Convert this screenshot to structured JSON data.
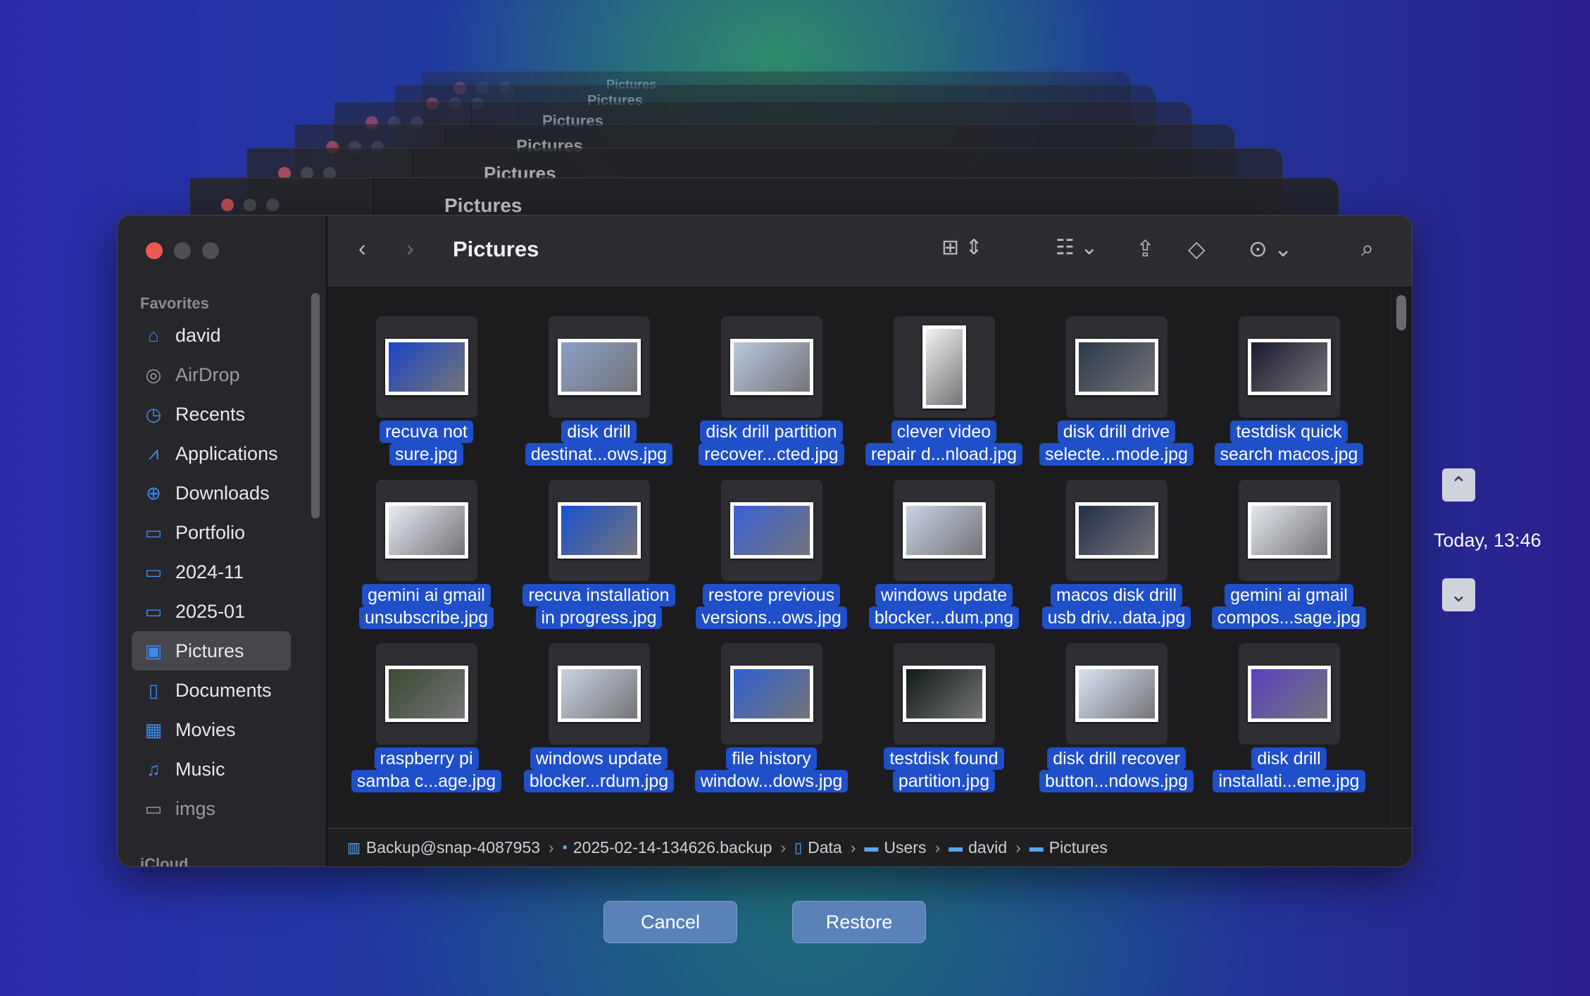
{
  "window": {
    "title": "Pictures"
  },
  "background_windows": [
    "Pictures",
    "Pictures",
    "Pictures",
    "Pictures",
    "Pictures",
    "Pictures"
  ],
  "sidebar": {
    "section_favorites": "Favorites",
    "section_icloud": "iCloud",
    "selected": "Pictures",
    "items": [
      {
        "label": "david",
        "icon": "house-icon",
        "glyph": "⌂"
      },
      {
        "label": "AirDrop",
        "icon": "airdrop-icon",
        "glyph": "◎",
        "gray": true
      },
      {
        "label": "Recents",
        "icon": "clock-icon",
        "glyph": "◷"
      },
      {
        "label": "Applications",
        "icon": "applications-icon",
        "glyph": "⩘"
      },
      {
        "label": "Downloads",
        "icon": "download-icon",
        "glyph": "⊕"
      },
      {
        "label": "Portfolio",
        "icon": "folder-icon",
        "glyph": "▭"
      },
      {
        "label": "2024-11",
        "icon": "folder-icon",
        "glyph": "▭"
      },
      {
        "label": "2025-01",
        "icon": "folder-icon",
        "glyph": "▭"
      },
      {
        "label": "Pictures",
        "icon": "pictures-icon",
        "glyph": "▣"
      },
      {
        "label": "Documents",
        "icon": "document-icon",
        "glyph": "▯"
      },
      {
        "label": "Movies",
        "icon": "film-icon",
        "glyph": "▦"
      },
      {
        "label": "Music",
        "icon": "music-icon",
        "glyph": "♫"
      },
      {
        "label": "imgs",
        "icon": "folder-icon",
        "glyph": "▭",
        "gray": true
      }
    ]
  },
  "toolbar": {
    "back": "‹",
    "forward": "›"
  },
  "files": [
    {
      "line1": "recuva not",
      "line2": "sure.jpg",
      "color": "#1a44c8"
    },
    {
      "line1": "disk drill",
      "line2": "destinat...ows.jpg",
      "color": "#8aa0c8"
    },
    {
      "line1": "disk drill partition",
      "line2": "recover...cted.jpg",
      "color": "#b8c8e0"
    },
    {
      "line1": "clever video",
      "line2": "repair d...nload.jpg",
      "color": "#f2f2f2",
      "tall": true
    },
    {
      "line1": "disk drill drive",
      "line2": "selecte...mode.jpg",
      "color": "#2a3a4a"
    },
    {
      "line1": "testdisk quick",
      "line2": "search macos.jpg",
      "color": "#1a1a30"
    },
    {
      "line1": "gemini ai gmail",
      "line2": "unsubscribe.jpg",
      "color": "#e8ecf4"
    },
    {
      "line1": "recuva installation",
      "line2": "in progress.jpg",
      "color": "#1a50d0"
    },
    {
      "line1": "restore previous",
      "line2": "versions...ows.jpg",
      "color": "#3a60d8"
    },
    {
      "line1": "windows update",
      "line2": "blocker...dum.png",
      "color": "#c8d4e4"
    },
    {
      "line1": "macos disk drill",
      "line2": "usb driv...data.jpg",
      "color": "#24304a"
    },
    {
      "line1": "gemini ai gmail",
      "line2": "compos...sage.jpg",
      "color": "#e4e8ee"
    },
    {
      "line1": "raspberry pi",
      "line2": "samba c...age.jpg",
      "color": "#3a4a30"
    },
    {
      "line1": "windows update",
      "line2": "blocker...rdum.jpg",
      "color": "#c8d4e4"
    },
    {
      "line1": "file history",
      "line2": "window...dows.jpg",
      "color": "#3060d0"
    },
    {
      "line1": "testdisk found",
      "line2": "partition.jpg",
      "color": "#101a14"
    },
    {
      "line1": "disk drill recover",
      "line2": "button...ndows.jpg",
      "color": "#d8e4f4"
    },
    {
      "line1": "disk drill",
      "line2": "installati...eme.jpg",
      "color": "#5a40c0"
    }
  ],
  "pathbar": [
    {
      "label": "Backup@snap-4087953",
      "icon": "backup-disk-icon",
      "glyph": "▥"
    },
    {
      "label": "2025-02-14-134626.backup",
      "icon": "backup-icon",
      "glyph": "▪"
    },
    {
      "label": "Data",
      "icon": "hard-drive-icon",
      "glyph": "▯"
    },
    {
      "label": "Users",
      "icon": "folder-icon",
      "glyph": "▬"
    },
    {
      "label": "david",
      "icon": "home-folder-icon",
      "glyph": "▬"
    },
    {
      "label": "Pictures",
      "icon": "pictures-folder-icon",
      "glyph": "▬"
    }
  ],
  "buttons": {
    "cancel": "Cancel",
    "restore": "Restore"
  },
  "timeline": {
    "label": "Today, 13:46"
  },
  "colors": {
    "selection": "#1f4fc9",
    "close": "#ec5a4f",
    "accent": "#3a8cf4"
  }
}
